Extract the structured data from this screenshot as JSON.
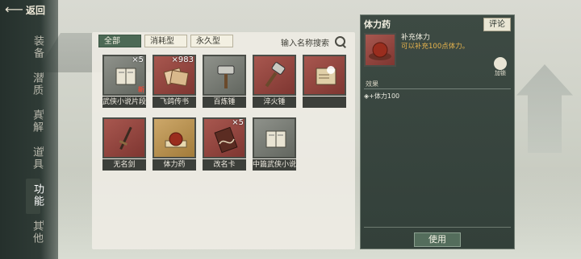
{
  "back_label": "返回",
  "nav": [
    {
      "label": "装备",
      "active": false
    },
    {
      "label": "潜质",
      "active": false
    },
    {
      "label": "真解",
      "active": false
    },
    {
      "label": "道具",
      "active": false
    },
    {
      "label": "功能",
      "active": true
    },
    {
      "label": "其他",
      "active": false
    }
  ],
  "tabs": [
    {
      "label": "全部",
      "active": true
    },
    {
      "label": "消耗型",
      "active": false
    },
    {
      "label": "永久型",
      "active": false
    }
  ],
  "search": {
    "placeholder": "输入名称搜索"
  },
  "items": [
    {
      "name": "武侠小说片段",
      "count": "×5",
      "frame": "gray",
      "icon": "book-icon",
      "badge": "新"
    },
    {
      "name": "飞鸽传书",
      "count": "×983",
      "frame": "red",
      "icon": "letter-icon",
      "badge": ""
    },
    {
      "name": "百炼锤",
      "count": "",
      "frame": "gray",
      "icon": "hammer-icon",
      "badge": ""
    },
    {
      "name": "淬火锤",
      "count": "",
      "frame": "red",
      "icon": "hammer-icon",
      "badge": ""
    },
    {
      "name": "",
      "count": "",
      "frame": "red",
      "icon": "scroll-icon",
      "badge": ""
    },
    {
      "name": "无名剑",
      "count": "",
      "frame": "red",
      "icon": "sword-icon",
      "badge": ""
    },
    {
      "name": "体力药",
      "count": "",
      "frame": "gold",
      "icon": "pill-icon",
      "badge": ""
    },
    {
      "name": "改名卡",
      "count": "×5",
      "frame": "red",
      "icon": "card-icon",
      "badge": ""
    },
    {
      "name": "中篇武侠小说",
      "count": "",
      "frame": "gray",
      "icon": "book-icon",
      "badge": ""
    }
  ],
  "detail": {
    "title": "体力药",
    "comment_label": "评论",
    "subtitle": "补充体力",
    "description": "可以补充100点体力。",
    "equip_label": "加锁",
    "section_label": "效果",
    "effect": "+体力100",
    "use_label": "使用"
  },
  "colors": {
    "accent_tab": "#4c6955",
    "desc_text": "#e8b44d",
    "panel_bg": "#3d4a43"
  }
}
